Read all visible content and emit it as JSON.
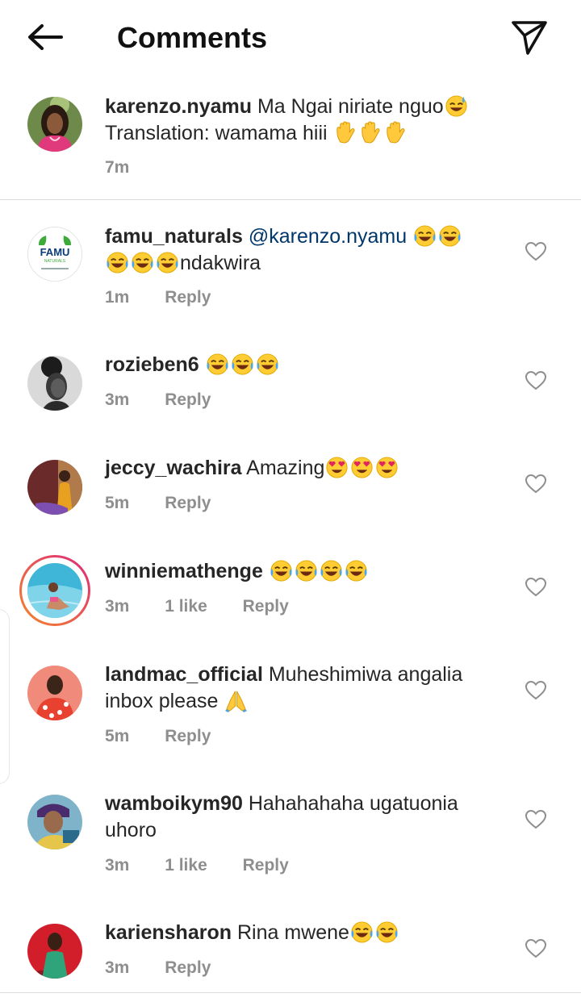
{
  "header": {
    "title": "Comments",
    "back_icon": "arrow-left-icon",
    "share_icon": "paper-plane-icon"
  },
  "caption": {
    "username": "karenzo.nyamu",
    "line1": "Ma Ngai niriate nguo",
    "line2": "Translation: wamama hiii",
    "time": "7m"
  },
  "comments": [
    {
      "username": "famu_naturals",
      "mention": "@karenzo.nyamu",
      "text_after": "ndakwira",
      "time": "1m",
      "reply": "Reply"
    },
    {
      "username": "rozieben6",
      "text": "",
      "time": "3m",
      "reply": "Reply"
    },
    {
      "username": "jeccy_wachira",
      "text": "Amazing",
      "time": "5m",
      "reply": "Reply"
    },
    {
      "username": "winniemathenge",
      "text": "",
      "time": "3m",
      "likes": "1 like",
      "reply": "Reply"
    },
    {
      "username": "landmac_official",
      "text": "Muheshimiwa angalia",
      "text2": "inbox please",
      "time": "5m",
      "reply": "Reply"
    },
    {
      "username": "wamboikym90",
      "text": "Hahahahaha ugatuonia",
      "text2": "uhoro",
      "time": "3m",
      "likes": "1 like",
      "reply": "Reply"
    },
    {
      "username": "kariensharon",
      "text": "Rina mwene",
      "time": "3m",
      "reply": "Reply"
    }
  ],
  "logo": {
    "brand": "FAMU",
    "sub": "NATURALS"
  },
  "colors": {
    "mention": "#00376b",
    "meta": "#8e8e8e",
    "divider": "#dbdbdb",
    "story_ring_start": "#f58529",
    "story_ring_end": "#dd2a7b"
  }
}
